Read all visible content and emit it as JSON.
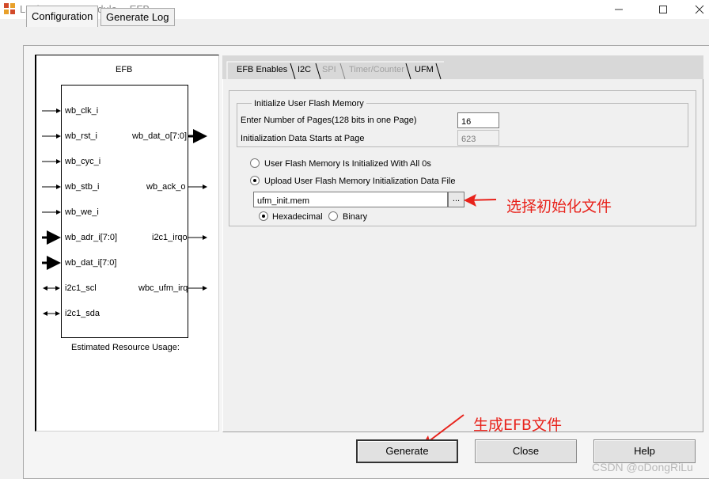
{
  "window": {
    "title": "Lattice FPGA Module -- EFB",
    "icon": "lattice-app-icon",
    "controls": [
      "minimize-icon",
      "maximize-icon",
      "close-icon"
    ]
  },
  "outer_tabs": [
    {
      "label": "Configuration",
      "active": true
    },
    {
      "label": "Generate Log",
      "active": false
    }
  ],
  "diagram": {
    "title": "EFB",
    "left_ports": [
      {
        "label": "wb_clk_i",
        "arrow": "in"
      },
      {
        "label": "wb_rst_i",
        "arrow": "in"
      },
      {
        "label": "wb_cyc_i",
        "arrow": "in"
      },
      {
        "label": "wb_stb_i",
        "arrow": "in"
      },
      {
        "label": "wb_we_i",
        "arrow": "in"
      },
      {
        "label": "wb_adr_i[7:0]",
        "arrow": "bus-in"
      },
      {
        "label": "wb_dat_i[7:0]",
        "arrow": "bus-in"
      },
      {
        "label": "i2c1_scl",
        "arrow": "bidir"
      },
      {
        "label": "i2c1_sda",
        "arrow": "bidir"
      }
    ],
    "right_ports": [
      {
        "label": "wb_dat_o[7:0]",
        "arrow": "bus-out"
      },
      {
        "label": "wb_ack_o",
        "arrow": "out"
      },
      {
        "label": "i2c1_irqo",
        "arrow": "out"
      },
      {
        "label": "wbc_ufm_irq",
        "arrow": "out"
      }
    ],
    "footer": "Estimated Resource Usage:"
  },
  "inner_tabs": [
    {
      "label": "EFB Enables",
      "enabled": true
    },
    {
      "label": "I2C",
      "enabled": true
    },
    {
      "label": "SPI",
      "enabled": false
    },
    {
      "label": "Timer/Counter",
      "enabled": false
    },
    {
      "label": "UFM",
      "enabled": true,
      "active": true
    }
  ],
  "ufm": {
    "group_title": "Initialize User Flash Memory",
    "pages_label": "Enter Number of Pages(128 bits in one Page)",
    "pages_value": "16",
    "start_label": "Initialization Data Starts at Page",
    "start_value": "623",
    "radio_zeros": "User Flash Memory Is Initialized With All 0s",
    "radio_upload": "Upload User Flash  Memory Initialization Data File",
    "file_value": "ufm_init.mem",
    "browse_label": "...",
    "format_hex": "Hexadecimal",
    "format_bin": "Binary"
  },
  "annotations": {
    "select_file": "选择初始化文件",
    "generate_efb": "生成EFB文件",
    "color": "#e8221b"
  },
  "buttons": {
    "generate": "Generate",
    "close": "Close",
    "help": "Help"
  },
  "watermark": "CSDN @oDongRiLu"
}
